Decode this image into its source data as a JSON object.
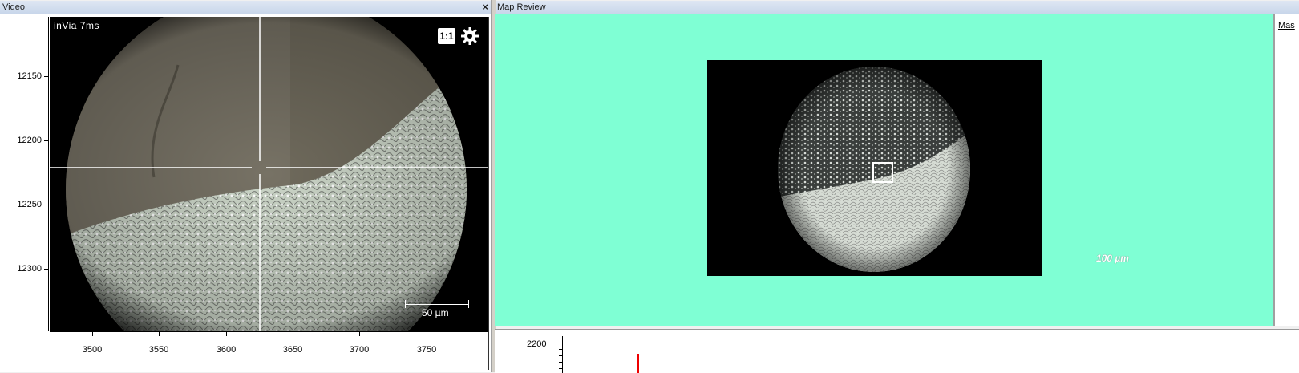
{
  "video_panel": {
    "title": "Video",
    "close_label": "×",
    "overlay_text": "inVia  7ms",
    "ratio_label": "1:1",
    "scale_label": "50 µm",
    "y_ticks": [
      "12150",
      "12200",
      "12250",
      "12300"
    ],
    "x_ticks": [
      "3500",
      "3550",
      "3600",
      "3650",
      "3700",
      "3750"
    ]
  },
  "map_panel": {
    "title": "Map Review",
    "scale_label": "100 µm",
    "background": "#7fffd4"
  },
  "right_panel": {
    "tab_label": "Mas"
  },
  "spectrum_panel": {
    "y_tick_label": "2200",
    "spike_color": "#e00000"
  },
  "icons": {
    "settings": "gear-icon",
    "close": "close-icon"
  }
}
